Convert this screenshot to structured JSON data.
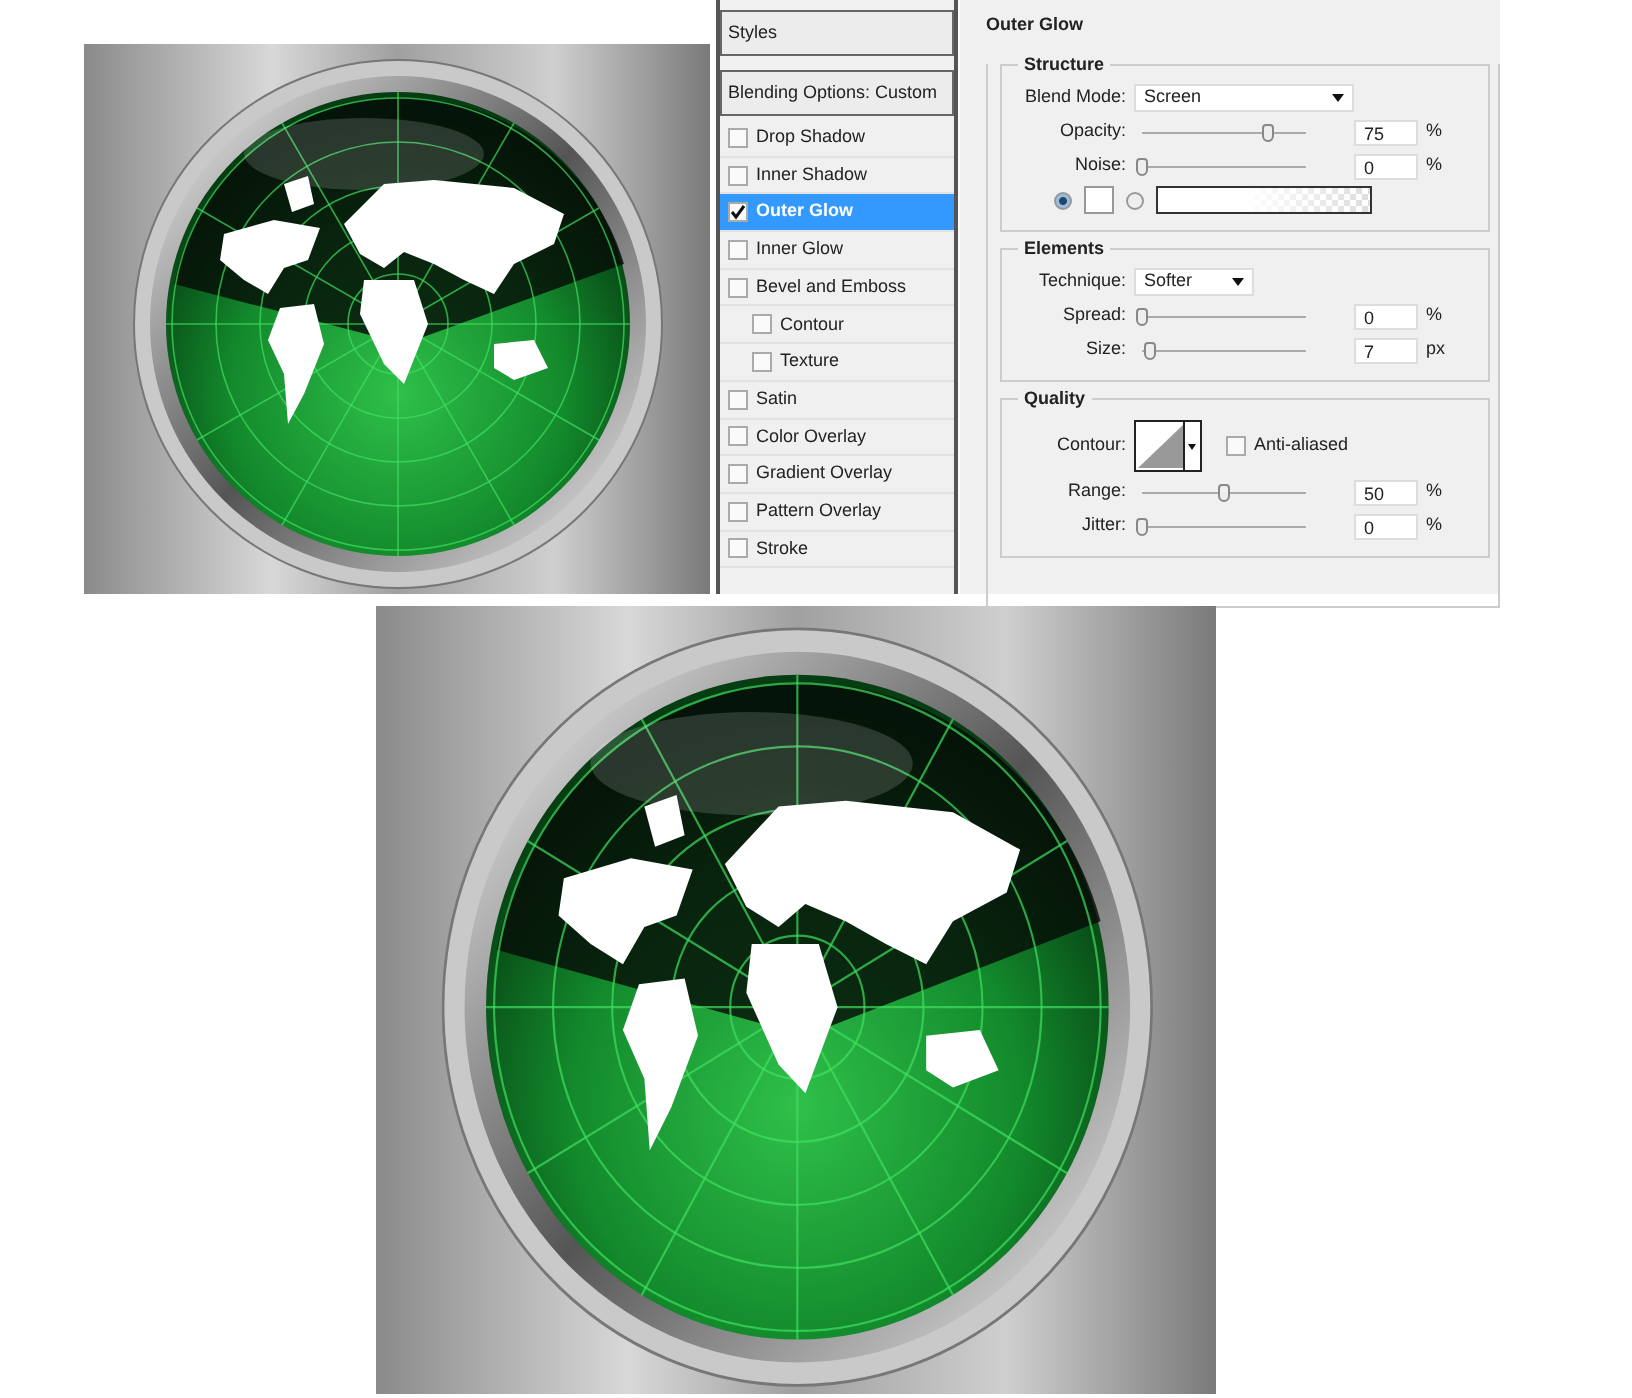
{
  "styles_panel": {
    "header": "Styles",
    "blending_options": "Blending Options: Custom",
    "items": [
      {
        "label": "Drop Shadow",
        "checked": false,
        "selected": false
      },
      {
        "label": "Inner Shadow",
        "checked": false,
        "selected": false
      },
      {
        "label": "Outer Glow",
        "checked": true,
        "selected": true
      },
      {
        "label": "Inner Glow",
        "checked": false,
        "selected": false
      },
      {
        "label": "Bevel and Emboss",
        "checked": false,
        "selected": false,
        "children": [
          {
            "label": "Contour",
            "checked": false,
            "selected": false
          },
          {
            "label": "Texture",
            "checked": false,
            "selected": false
          }
        ]
      },
      {
        "label": "Satin",
        "checked": false,
        "selected": false
      },
      {
        "label": "Color Overlay",
        "checked": false,
        "selected": false
      },
      {
        "label": "Gradient Overlay",
        "checked": false,
        "selected": false
      },
      {
        "label": "Pattern Overlay",
        "checked": false,
        "selected": false
      },
      {
        "label": "Stroke",
        "checked": false,
        "selected": false
      }
    ]
  },
  "outer_glow": {
    "title": "Outer Glow",
    "structure": {
      "title": "Structure",
      "blend_mode": {
        "label": "Blend Mode:",
        "value": "Screen"
      },
      "sliders": [
        {
          "label": "Opacity:",
          "level": 0.77,
          "value": "75",
          "unit": "%"
        },
        {
          "label": "Noise:",
          "level": 0,
          "value": "0",
          "unit": "%"
        }
      ],
      "fill": [
        {
          "kind": "color",
          "selected": true
        },
        {
          "kind": "gradient",
          "selected": false
        }
      ]
    },
    "elements": {
      "title": "Elements",
      "technique": {
        "label": "Technique:",
        "value": "Softer"
      },
      "sliders": [
        {
          "label": "Spread:",
          "level": 0,
          "value": "0",
          "unit": "%"
        },
        {
          "label": "Size:",
          "level": 0.05,
          "value": "7",
          "unit": "px"
        }
      ]
    },
    "quality": {
      "title": "Quality",
      "contour_label": "Contour:",
      "anti_aliased": {
        "label": "Anti-aliased",
        "checked": false
      },
      "sliders": [
        {
          "label": "Range:",
          "level": 0.5,
          "value": "50",
          "unit": "%"
        },
        {
          "label": "Jitter:",
          "level": 0,
          "value": "0",
          "unit": "%"
        }
      ]
    }
  }
}
